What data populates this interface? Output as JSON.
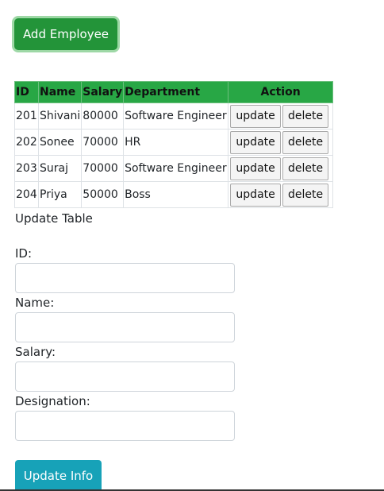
{
  "add_button": {
    "label": "Add Employee"
  },
  "table": {
    "headers": {
      "id": "ID",
      "name": "Name",
      "salary": "Salary",
      "department": "Department",
      "action": "Action"
    },
    "rows": [
      {
        "id": "201",
        "name": "Shivani",
        "salary": "80000",
        "department": "Software Engineer",
        "update": "update",
        "delete": "delete"
      },
      {
        "id": "202",
        "name": "Sonee",
        "salary": "70000",
        "department": "HR",
        "update": "update",
        "delete": "delete"
      },
      {
        "id": "203",
        "name": "Suraj",
        "salary": "70000",
        "department": "Software Engineer",
        "update": "update",
        "delete": "delete"
      },
      {
        "id": "204",
        "name": "Priya",
        "salary": "50000",
        "department": "Boss",
        "update": "update",
        "delete": "delete"
      }
    ]
  },
  "form": {
    "title": "Update Table",
    "id_label": "ID:",
    "id_value": "",
    "name_label": "Name:",
    "name_value": "",
    "salary_label": "Salary:",
    "salary_value": "",
    "designation_label": "Designation:",
    "designation_value": "",
    "submit_label": "Update Info"
  },
  "colors": {
    "add_button": "#239439",
    "table_header": "#28a745",
    "submit_button": "#17a2b8"
  }
}
